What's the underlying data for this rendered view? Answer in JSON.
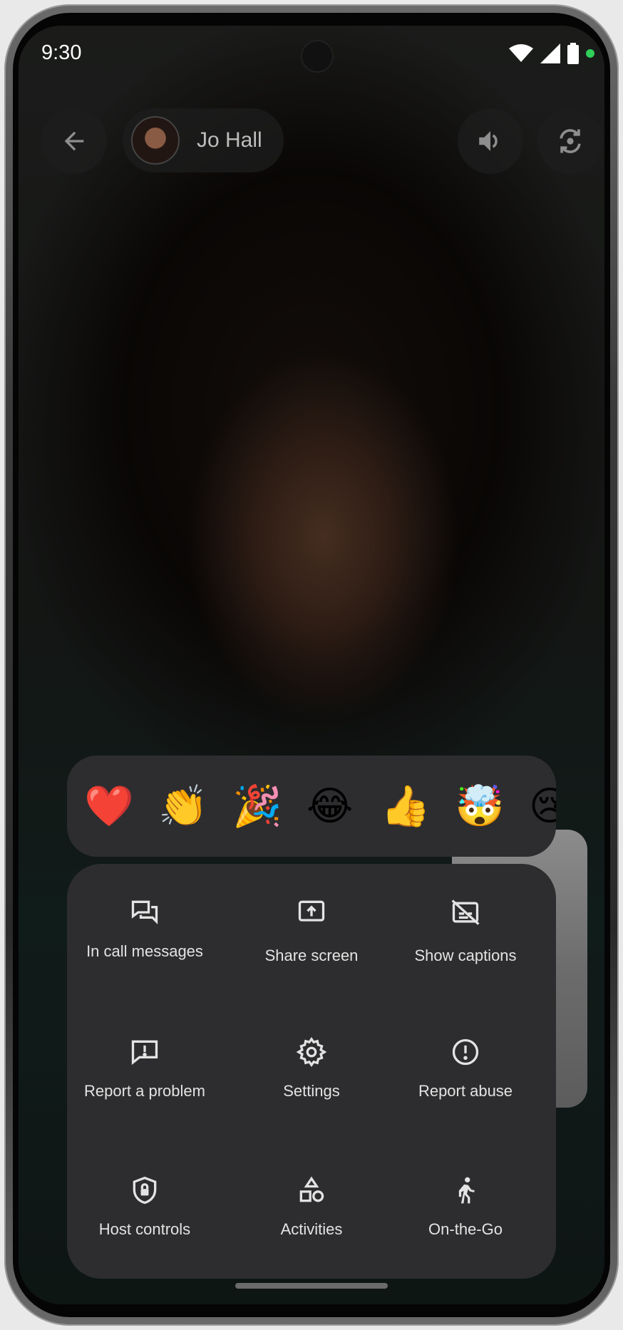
{
  "status_bar": {
    "time": "9:30"
  },
  "call": {
    "participant_name": "Jo Hall"
  },
  "reactions": [
    "❤️",
    "👏",
    "🎉",
    "😂",
    "👍",
    "🤯",
    "😢"
  ],
  "menu": [
    {
      "icon": "chat-bubbles-icon",
      "label": "In call messages"
    },
    {
      "icon": "share-screen-icon",
      "label": "Share screen"
    },
    {
      "icon": "captions-off-icon",
      "label": "Show captions"
    },
    {
      "icon": "report-feedback-icon",
      "label": "Report a problem"
    },
    {
      "icon": "gear-icon",
      "label": "Settings"
    },
    {
      "icon": "alert-circle-icon",
      "label": "Report abuse"
    },
    {
      "icon": "shield-lock-icon",
      "label": "Host controls"
    },
    {
      "icon": "shapes-icon",
      "label": "Activities"
    },
    {
      "icon": "walking-person-icon",
      "label": "On-the-Go"
    }
  ],
  "colors": {
    "panel": "#2d2d2f",
    "text": "#e3e3e3",
    "control_bg": "#1e1e1e"
  }
}
